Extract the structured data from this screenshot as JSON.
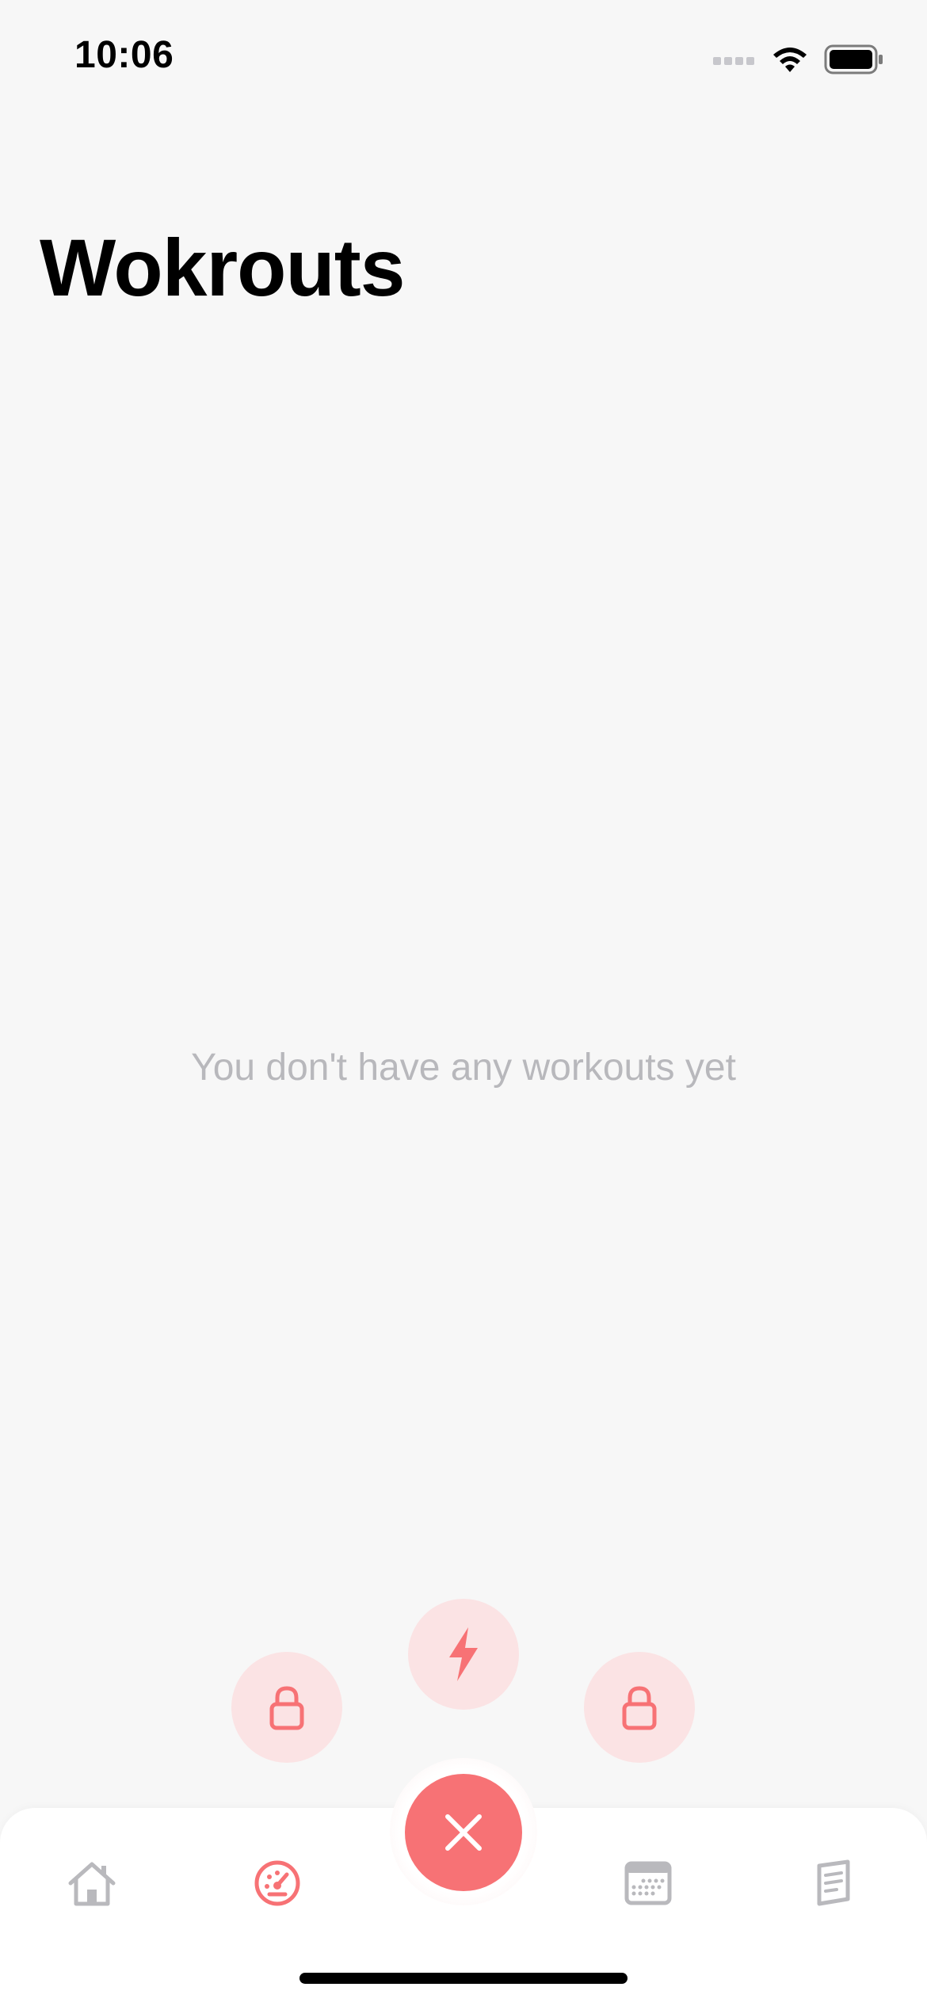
{
  "status_bar": {
    "time": "10:06"
  },
  "header": {
    "title": "Wokrouts"
  },
  "main": {
    "empty_message": "You don't have any workouts yet"
  },
  "fab_menu": {
    "options": [
      {
        "icon": "lock-icon",
        "locked": true
      },
      {
        "icon": "lightning-icon",
        "locked": false
      },
      {
        "icon": "lock-icon",
        "locked": true
      }
    ],
    "close_icon": "close-icon"
  },
  "tab_bar": {
    "items": [
      {
        "icon": "home-icon",
        "active": false
      },
      {
        "icon": "speedometer-icon",
        "active": true
      },
      {
        "icon": "calendar-icon",
        "active": false
      },
      {
        "icon": "notes-icon",
        "active": false
      }
    ]
  },
  "colors": {
    "accent": "#f77275",
    "accent_light": "#fbe3e4",
    "inactive_icon": "#b9b9bd",
    "background": "#f7f7f7"
  }
}
